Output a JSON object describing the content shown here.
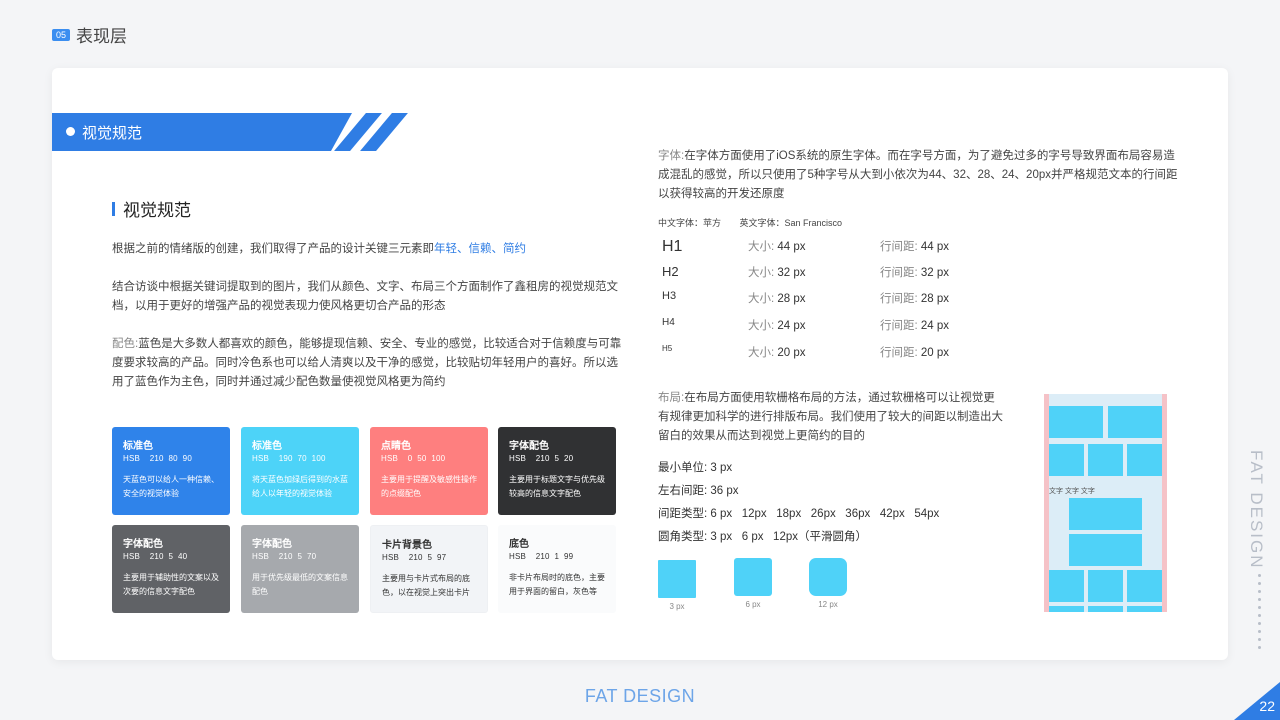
{
  "header": {
    "section_number": "05",
    "section_title": "表现层"
  },
  "banner": {
    "title": "视觉规范"
  },
  "left": {
    "heading": "视觉规范",
    "p1_text": "根据之前的情绪版的创建，我们取得了产品的设计关键三元素即",
    "p1_keywords": "年轻、信赖、简约",
    "p2": "结合访谈中根据关键词提取到的图片，我们从颜色、文字、布局三个方面制作了鑫租房的视觉规范文档，以用于更好的增强产品的视觉表现力使风格更切合产品的形态",
    "p3_label": "配色:",
    "p3": "蓝色是大多数人都喜欢的颜色，能够提现信赖、安全、专业的感觉，比较适合对于信赖度与可靠度要求较高的产品。同时冷色系也可以给人清爽以及干净的感觉，比较贴切年轻用户的喜好。所以选用了蓝色作为主色，同时并通过减少配色数量使视觉风格更为简约"
  },
  "swatches": [
    {
      "name": "标准色",
      "hsb": "HSB    210  80  90",
      "desc": "天蓝色可以给人一种信赖、安全的视觉体验",
      "color": "#2f83ea"
    },
    {
      "name": "标准色",
      "hsb": "HSB    190  70  100",
      "desc": "将天蓝色加绿后得到的水蓝给人以年轻的视觉体验",
      "color": "#4dd3f8"
    },
    {
      "name": "点睛色",
      "hsb": "HSB    0  50  100",
      "desc": "主要用于提醒及敏感性操作的点缀配色",
      "color": "#fe7f7f"
    },
    {
      "name": "字体配色",
      "hsb": "HSB    210  5  20",
      "desc": "主要用于标题文字与优先级较高的信息文字配色",
      "color": "#303133"
    },
    {
      "name": "字体配色",
      "hsb": "HSB    210  5  40",
      "desc": "主要用于辅助性的文案以及次要的信息文字配色",
      "color": "#606266"
    },
    {
      "name": "字体配色",
      "hsb": "HSB    210  5  70",
      "desc": "用于优先级最低的文案信息配色",
      "color": "#a6a9ad"
    },
    {
      "name": "卡片背景色",
      "hsb": "HSB    210  5  97",
      "desc": "主要用与卡片式布局的底色，以在视觉上突出卡片",
      "color": "#f2f4f7"
    },
    {
      "name": "底色",
      "hsb": "HSB    210  1  99",
      "desc": "非卡片布局时的底色，主要用于界面的留白，灰色等",
      "color": "#fafbfc"
    }
  ],
  "typography": {
    "label": "字体:",
    "text": "在字体方面使用了iOS系统的原生字体。而在字号方面，为了避免过多的字号导致界面布局容易造成混乱的感觉，所以只使用了5种字号从大到小依次为44、32、28、24、20px并严格规范文本的行间距以获得较高的开发还原度",
    "cn_font": "中文字体：苹方",
    "en_font": "英文字体：San Francisco",
    "size_key": "大小:",
    "lh_key": "行间距:",
    "rows": [
      {
        "name": "H1",
        "size": "44 px",
        "line_height": "44 px"
      },
      {
        "name": "H2",
        "size": "32 px",
        "line_height": "32 px"
      },
      {
        "name": "H3",
        "size": "28 px",
        "line_height": "28 px"
      },
      {
        "name": "H4",
        "size": "24 px",
        "line_height": "24 px"
      },
      {
        "name": "H5",
        "size": "20 px",
        "line_height": "20 px"
      }
    ]
  },
  "layout": {
    "label": "布局:",
    "text": "在布局方面使用软栅格布局的方法，通过软栅格可以让视觉更有规律更加科学的进行排版布局。我们使用了较大的间距以制造出大留白的效果从而达到视觉上更简约的目的",
    "min_unit_key": "最小单位:",
    "min_unit": "3 px",
    "margin_key": "左右间距:",
    "margin": "36 px",
    "gap_key": "间距类型:",
    "gaps": "6 px   12px   18px   26px   36px   42px   54px",
    "radius_key": "圆角类型:",
    "radii": "3 px   6 px   12px（平滑圆角）",
    "radius_samples": [
      "3 px",
      "6 px",
      "12 px"
    ],
    "grid_text": "文字  文字  文字"
  },
  "side": {
    "vertical_text": "FAT DESIGN"
  },
  "footer": {
    "brand": "FAT DESIGN",
    "page_number": "22"
  }
}
